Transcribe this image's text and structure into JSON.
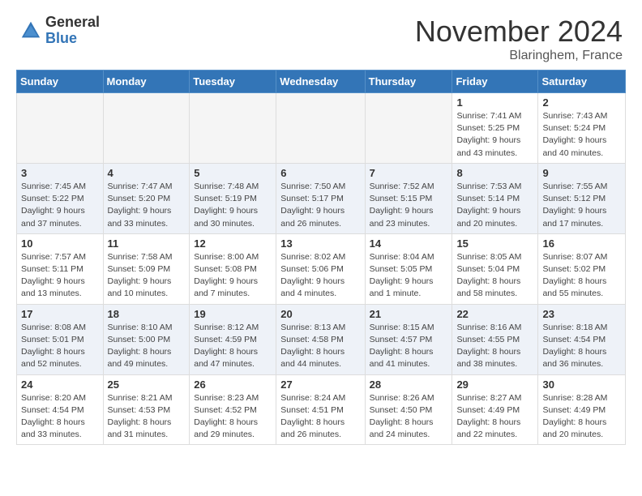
{
  "header": {
    "logo_general": "General",
    "logo_blue": "Blue",
    "month_title": "November 2024",
    "location": "Blaringhem, France"
  },
  "days_of_week": [
    "Sunday",
    "Monday",
    "Tuesday",
    "Wednesday",
    "Thursday",
    "Friday",
    "Saturday"
  ],
  "weeks": [
    [
      {
        "day": "",
        "info": ""
      },
      {
        "day": "",
        "info": ""
      },
      {
        "day": "",
        "info": ""
      },
      {
        "day": "",
        "info": ""
      },
      {
        "day": "",
        "info": ""
      },
      {
        "day": "1",
        "info": "Sunrise: 7:41 AM\nSunset: 5:25 PM\nDaylight: 9 hours\nand 43 minutes."
      },
      {
        "day": "2",
        "info": "Sunrise: 7:43 AM\nSunset: 5:24 PM\nDaylight: 9 hours\nand 40 minutes."
      }
    ],
    [
      {
        "day": "3",
        "info": "Sunrise: 7:45 AM\nSunset: 5:22 PM\nDaylight: 9 hours\nand 37 minutes."
      },
      {
        "day": "4",
        "info": "Sunrise: 7:47 AM\nSunset: 5:20 PM\nDaylight: 9 hours\nand 33 minutes."
      },
      {
        "day": "5",
        "info": "Sunrise: 7:48 AM\nSunset: 5:19 PM\nDaylight: 9 hours\nand 30 minutes."
      },
      {
        "day": "6",
        "info": "Sunrise: 7:50 AM\nSunset: 5:17 PM\nDaylight: 9 hours\nand 26 minutes."
      },
      {
        "day": "7",
        "info": "Sunrise: 7:52 AM\nSunset: 5:15 PM\nDaylight: 9 hours\nand 23 minutes."
      },
      {
        "day": "8",
        "info": "Sunrise: 7:53 AM\nSunset: 5:14 PM\nDaylight: 9 hours\nand 20 minutes."
      },
      {
        "day": "9",
        "info": "Sunrise: 7:55 AM\nSunset: 5:12 PM\nDaylight: 9 hours\nand 17 minutes."
      }
    ],
    [
      {
        "day": "10",
        "info": "Sunrise: 7:57 AM\nSunset: 5:11 PM\nDaylight: 9 hours\nand 13 minutes."
      },
      {
        "day": "11",
        "info": "Sunrise: 7:58 AM\nSunset: 5:09 PM\nDaylight: 9 hours\nand 10 minutes."
      },
      {
        "day": "12",
        "info": "Sunrise: 8:00 AM\nSunset: 5:08 PM\nDaylight: 9 hours\nand 7 minutes."
      },
      {
        "day": "13",
        "info": "Sunrise: 8:02 AM\nSunset: 5:06 PM\nDaylight: 9 hours\nand 4 minutes."
      },
      {
        "day": "14",
        "info": "Sunrise: 8:04 AM\nSunset: 5:05 PM\nDaylight: 9 hours\nand 1 minute."
      },
      {
        "day": "15",
        "info": "Sunrise: 8:05 AM\nSunset: 5:04 PM\nDaylight: 8 hours\nand 58 minutes."
      },
      {
        "day": "16",
        "info": "Sunrise: 8:07 AM\nSunset: 5:02 PM\nDaylight: 8 hours\nand 55 minutes."
      }
    ],
    [
      {
        "day": "17",
        "info": "Sunrise: 8:08 AM\nSunset: 5:01 PM\nDaylight: 8 hours\nand 52 minutes."
      },
      {
        "day": "18",
        "info": "Sunrise: 8:10 AM\nSunset: 5:00 PM\nDaylight: 8 hours\nand 49 minutes."
      },
      {
        "day": "19",
        "info": "Sunrise: 8:12 AM\nSunset: 4:59 PM\nDaylight: 8 hours\nand 47 minutes."
      },
      {
        "day": "20",
        "info": "Sunrise: 8:13 AM\nSunset: 4:58 PM\nDaylight: 8 hours\nand 44 minutes."
      },
      {
        "day": "21",
        "info": "Sunrise: 8:15 AM\nSunset: 4:57 PM\nDaylight: 8 hours\nand 41 minutes."
      },
      {
        "day": "22",
        "info": "Sunrise: 8:16 AM\nSunset: 4:55 PM\nDaylight: 8 hours\nand 38 minutes."
      },
      {
        "day": "23",
        "info": "Sunrise: 8:18 AM\nSunset: 4:54 PM\nDaylight: 8 hours\nand 36 minutes."
      }
    ],
    [
      {
        "day": "24",
        "info": "Sunrise: 8:20 AM\nSunset: 4:54 PM\nDaylight: 8 hours\nand 33 minutes."
      },
      {
        "day": "25",
        "info": "Sunrise: 8:21 AM\nSunset: 4:53 PM\nDaylight: 8 hours\nand 31 minutes."
      },
      {
        "day": "26",
        "info": "Sunrise: 8:23 AM\nSunset: 4:52 PM\nDaylight: 8 hours\nand 29 minutes."
      },
      {
        "day": "27",
        "info": "Sunrise: 8:24 AM\nSunset: 4:51 PM\nDaylight: 8 hours\nand 26 minutes."
      },
      {
        "day": "28",
        "info": "Sunrise: 8:26 AM\nSunset: 4:50 PM\nDaylight: 8 hours\nand 24 minutes."
      },
      {
        "day": "29",
        "info": "Sunrise: 8:27 AM\nSunset: 4:49 PM\nDaylight: 8 hours\nand 22 minutes."
      },
      {
        "day": "30",
        "info": "Sunrise: 8:28 AM\nSunset: 4:49 PM\nDaylight: 8 hours\nand 20 minutes."
      }
    ]
  ]
}
